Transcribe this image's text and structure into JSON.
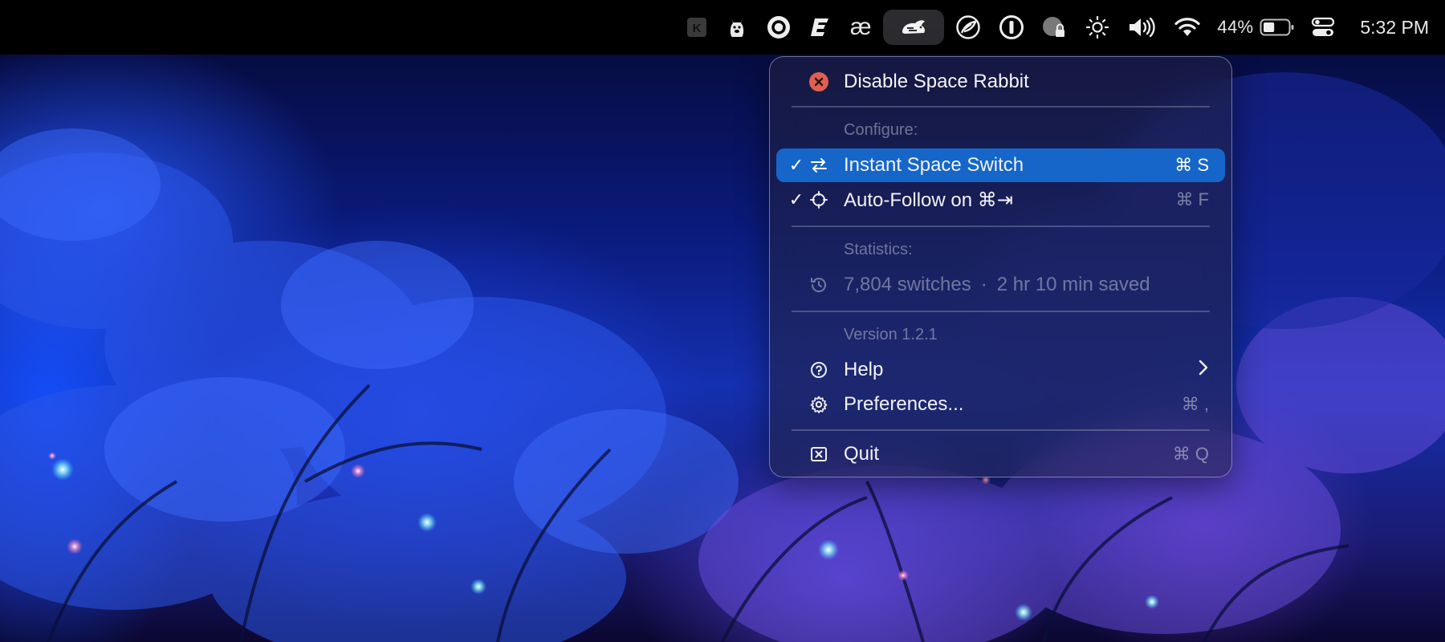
{
  "menubar": {
    "items": [
      {
        "name": "k-app-icon"
      },
      {
        "name": "llama-app-icon"
      },
      {
        "name": "ring-app-icon"
      },
      {
        "name": "e-app-icon"
      },
      {
        "name": "ae-app-icon",
        "text": "æ"
      },
      {
        "name": "space-rabbit-icon",
        "active": true
      },
      {
        "name": "feather-app-icon"
      },
      {
        "name": "onepassword-icon"
      },
      {
        "name": "privacy-lock-icon"
      },
      {
        "name": "brightness-icon"
      },
      {
        "name": "volume-icon"
      },
      {
        "name": "wifi-icon"
      }
    ],
    "battery_percent": "44%",
    "battery_level": 0.44,
    "clock": "5:32 PM"
  },
  "menu": {
    "disable_label": "Disable Space Rabbit",
    "configure_header": "Configure:",
    "instant_switch": {
      "label": "Instant Space Switch",
      "shortcut": "⌘ S",
      "checked": true
    },
    "auto_follow": {
      "label": "Auto-Follow on ⌘⇥",
      "shortcut": "⌘ F",
      "checked": true
    },
    "statistics_header": "Statistics:",
    "switches": "7,804 switches",
    "separator": "·",
    "saved": "2 hr 10 min saved",
    "version": "Version 1.2.1",
    "help_label": "Help",
    "preferences": {
      "label": "Preferences...",
      "shortcut": "⌘ ,"
    },
    "quit": {
      "label": "Quit",
      "shortcut": "⌘ Q"
    }
  },
  "colors": {
    "selection": "#1566c8",
    "disable_red": "#e0604f",
    "menubar_bg": "#000000"
  }
}
